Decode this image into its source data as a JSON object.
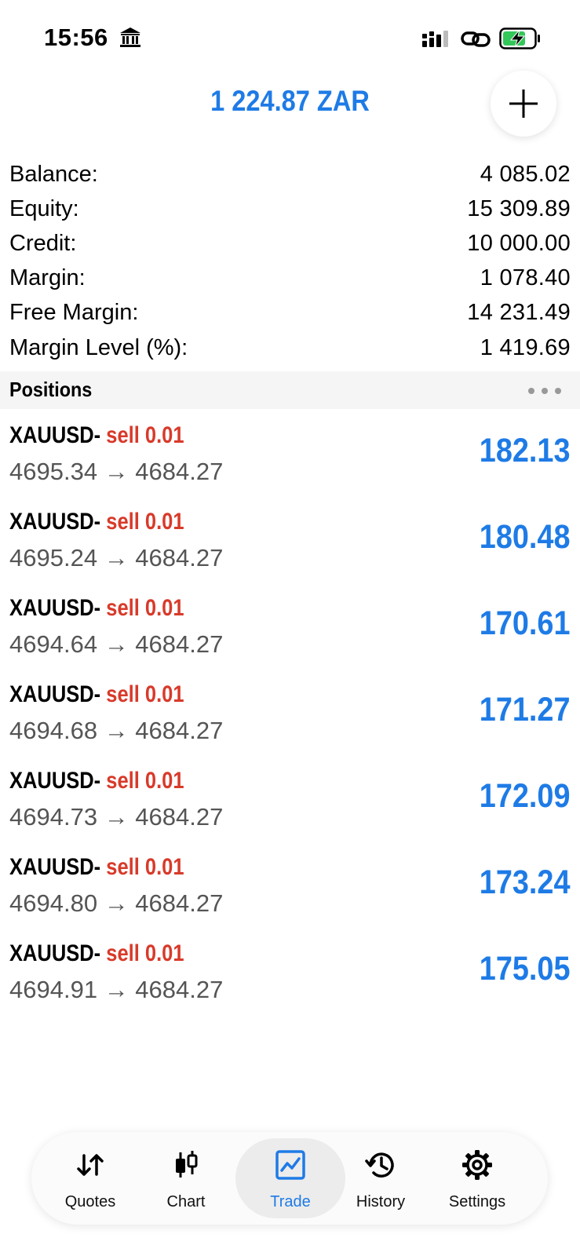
{
  "status_bar": {
    "time": "15:56"
  },
  "header": {
    "balance": "1 224.87 ZAR"
  },
  "summary": [
    {
      "label": "Balance:",
      "value": "4 085.02"
    },
    {
      "label": "Equity:",
      "value": "15 309.89"
    },
    {
      "label": "Credit:",
      "value": "10 000.00"
    },
    {
      "label": "Margin:",
      "value": "1 078.40"
    },
    {
      "label": "Free Margin:",
      "value": "14 231.49"
    },
    {
      "label": "Margin Level (%):",
      "value": "1 419.69"
    }
  ],
  "positions": {
    "title": "Positions",
    "items": [
      {
        "symbol": "XAUUSD-",
        "side": "sell 0.01",
        "prices": "4695.34 → 4684.27",
        "profit": "182.13"
      },
      {
        "symbol": "XAUUSD-",
        "side": "sell 0.01",
        "prices": "4695.24 → 4684.27",
        "profit": "180.48"
      },
      {
        "symbol": "XAUUSD-",
        "side": "sell 0.01",
        "prices": "4694.64 → 4684.27",
        "profit": "170.61"
      },
      {
        "symbol": "XAUUSD-",
        "side": "sell 0.01",
        "prices": "4694.68 → 4684.27",
        "profit": "171.27"
      },
      {
        "symbol": "XAUUSD-",
        "side": "sell 0.01",
        "prices": "4694.73 → 4684.27",
        "profit": "172.09"
      },
      {
        "symbol": "XAUUSD-",
        "side": "sell 0.01",
        "prices": "4694.80 → 4684.27",
        "profit": "173.24"
      },
      {
        "symbol": "XAUUSD-",
        "side": "sell 0.01",
        "prices": "4694.91 → 4684.27",
        "profit": "175.05"
      }
    ]
  },
  "tabs": [
    {
      "label": "Quotes",
      "icon": "quotes-arrows-icon"
    },
    {
      "label": "Chart",
      "icon": "candlestick-icon"
    },
    {
      "label": "Trade",
      "icon": "trade-chart-icon",
      "active": true
    },
    {
      "label": "History",
      "icon": "history-icon"
    },
    {
      "label": "Settings",
      "icon": "gear-icon"
    }
  ],
  "colors": {
    "accent": "#1e7be6",
    "sell": "#d83a2a",
    "battery": "#34c759"
  }
}
